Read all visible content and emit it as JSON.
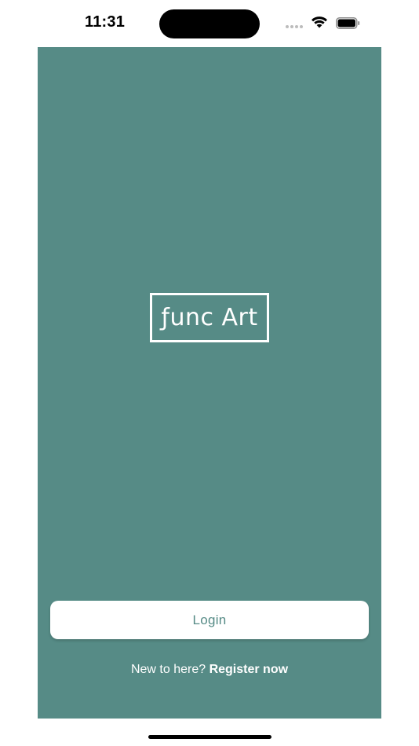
{
  "status_bar": {
    "time": "11:31",
    "icons": [
      "signal-icon",
      "wifi-icon",
      "battery-icon"
    ]
  },
  "colors": {
    "brand": "#568b86",
    "surface": "#ffffff"
  },
  "logo": {
    "prefix": "ƒ",
    "text": "unc Art"
  },
  "login": {
    "label": "Login"
  },
  "register": {
    "prompt": "New to here?",
    "link_label": "Register now"
  }
}
